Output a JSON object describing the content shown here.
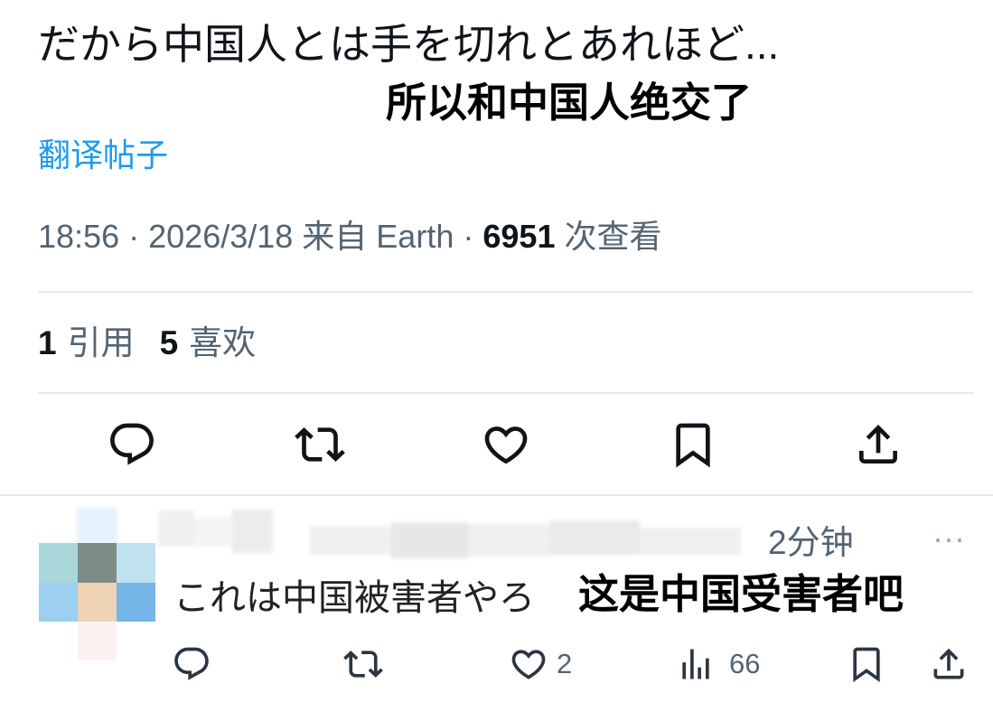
{
  "colors": {
    "text_primary": "#0f1419",
    "text_secondary": "#536471",
    "link": "#1d9bf0",
    "divider": "#e6e8ea"
  },
  "post": {
    "text": "だから中国人とは手を切れとあれほど...",
    "translation_overlay": "所以和中国人绝交了",
    "translate_link": "翻译帖子",
    "meta": {
      "time": "18:56",
      "separator": "·",
      "date": "2026/3/18",
      "source": "来自 Earth",
      "views_count": "6951",
      "views_label": "次查看"
    },
    "stats": {
      "quotes_count": "1",
      "quotes_label": "引用",
      "likes_count": "5",
      "likes_label": "喜欢"
    },
    "actions": [
      {
        "icon": "reply-icon"
      },
      {
        "icon": "retweet-icon"
      },
      {
        "icon": "heart-icon"
      },
      {
        "icon": "bookmark-icon"
      },
      {
        "icon": "share-icon"
      }
    ]
  },
  "reply": {
    "time": "2分钟",
    "more": "···",
    "text": "これは中国被害者やろ",
    "translation_overlay": "这是中国受害者吧",
    "likes_count": "2",
    "views_count": "66",
    "actions": [
      {
        "icon": "reply-icon"
      },
      {
        "icon": "retweet-icon"
      },
      {
        "icon": "heart-icon"
      },
      {
        "icon": "views-icon"
      },
      {
        "icon": "bookmark-icon"
      },
      {
        "icon": "share-icon"
      }
    ]
  }
}
